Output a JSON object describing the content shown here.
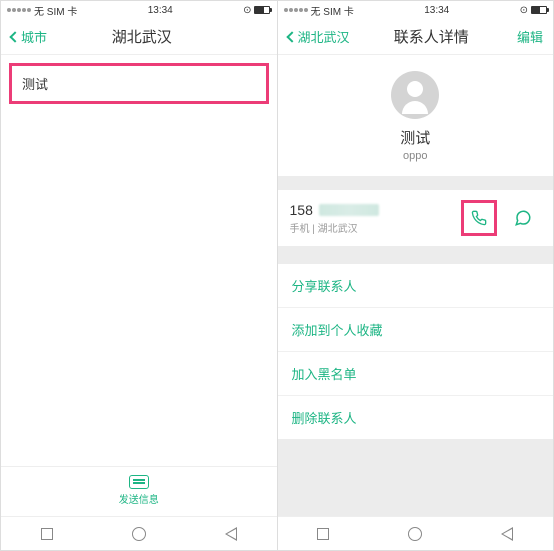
{
  "left": {
    "status": {
      "carrier": "无 SIM 卡",
      "time": "13:34"
    },
    "nav": {
      "back": "城市",
      "title": "湖北武汉"
    },
    "search_value": "测试",
    "bottom_action": "发送信息"
  },
  "right": {
    "status": {
      "carrier": "无 SIM 卡",
      "time": "13:34"
    },
    "nav": {
      "back": "湖北武汉",
      "title": "联系人详情",
      "right": "编辑"
    },
    "contact": {
      "name": "测试",
      "sub": "oppo"
    },
    "phone": {
      "number_prefix": "158",
      "meta": "手机 | 湖北武汉"
    },
    "actions": [
      "分享联系人",
      "添加到个人收藏",
      "加入黑名单",
      "删除联系人"
    ]
  }
}
